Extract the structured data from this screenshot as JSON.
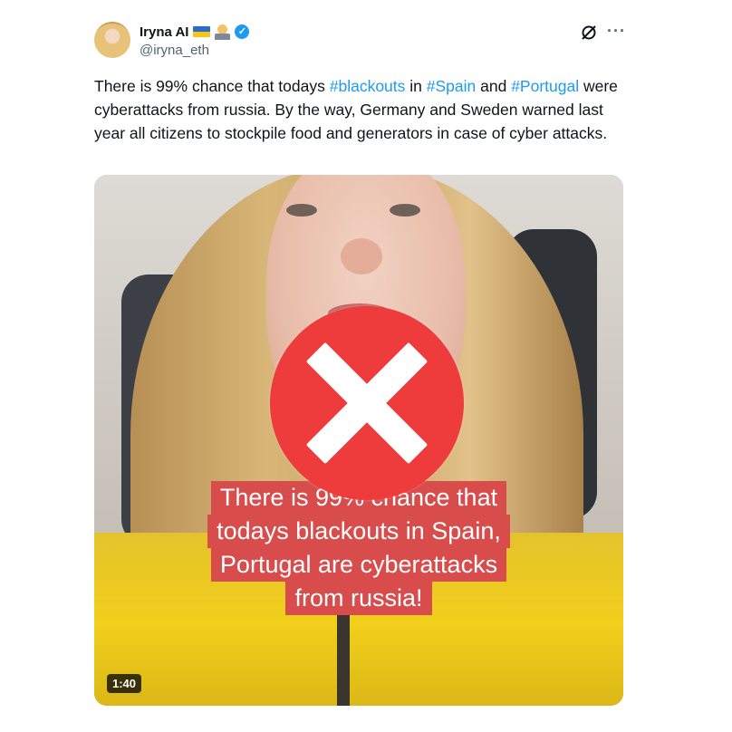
{
  "author": {
    "name": "Iryna AI",
    "handle": "@iryna_eth",
    "verified": true,
    "badges": [
      "ukraine-flag-icon",
      "technologist-emoji-icon"
    ]
  },
  "header_icons": [
    "grok-icon",
    "more-options-icon"
  ],
  "tweet": {
    "segments": [
      {
        "text": "There is 99% chance that todays ",
        "type": "text"
      },
      {
        "text": "#blackouts",
        "type": "hashtag"
      },
      {
        "text": " in ",
        "type": "text"
      },
      {
        "text": "#Spain",
        "type": "hashtag"
      },
      {
        "text": " and ",
        "type": "text"
      },
      {
        "text": "#Portugal",
        "type": "hashtag"
      },
      {
        "text": " were cyberattacks from russia. By the way, Germany and Sweden warned last year all citizens to stockpile food and generators in case of cyber attacks.",
        "type": "text"
      }
    ]
  },
  "video": {
    "caption_lines": [
      "There is 99% chance that",
      "todays blackouts in Spain,",
      "Portugal are cyberattacks",
      "from russia!"
    ],
    "duration": "1:40",
    "overlay": "red-x-icon"
  },
  "colors": {
    "hashtag": "#1d9bf0",
    "verified": "#1d9bf0",
    "x_overlay": "#ee3b3b",
    "caption_bg": "#d94c4c"
  }
}
